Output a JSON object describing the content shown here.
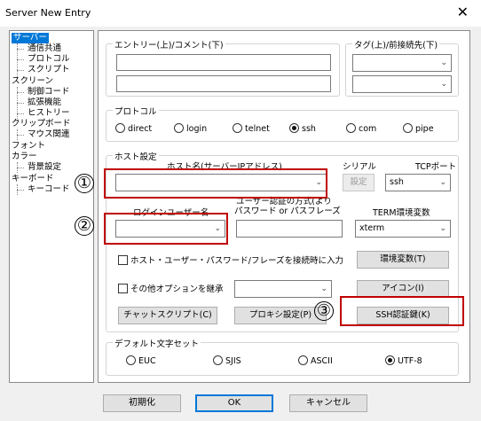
{
  "window": {
    "title": "Server New Entry",
    "close_glyph": "✕"
  },
  "tree": {
    "items": [
      {
        "label": "サーバー",
        "selected": true
      },
      {
        "label": "通信共通"
      },
      {
        "label": "プロトコル"
      },
      {
        "label": "スクリプト"
      },
      {
        "label": "スクリーン"
      },
      {
        "label": "制御コード"
      },
      {
        "label": "拡張機能"
      },
      {
        "label": "ヒストリー"
      },
      {
        "label": "クリップボード"
      },
      {
        "label": "マウス関連"
      },
      {
        "label": "フォント"
      },
      {
        "label": "カラー"
      },
      {
        "label": "背景設定"
      },
      {
        "label": "キーボード"
      },
      {
        "label": "キーコード"
      }
    ]
  },
  "entry": {
    "group_label": "エントリー(上)/コメント(下)",
    "entry_value": "",
    "comment_value": ""
  },
  "tag": {
    "group_label": "タグ(上)/前接続先(下)",
    "tag_value": "",
    "prev_value": ""
  },
  "protocol": {
    "group_label": "プロトコル",
    "options": [
      "direct",
      "login",
      "telnet",
      "ssh",
      "com",
      "pipe"
    ],
    "selected": "ssh"
  },
  "host": {
    "group_label": "ホスト設定",
    "host_label": "ホスト名(サーバーIPアドレス)",
    "host_value": "",
    "serial_label": "シリアル",
    "serial_button": "設定",
    "tcp_label": "TCPポート",
    "tcp_value": "ssh",
    "login_label": "ログインユーザー名",
    "login_value": "",
    "auth_label_1": "ユーザー認証の方式(より",
    "auth_label_2": "パスワード or パスフレーズ",
    "auth_value": "",
    "term_label": "TERM環境変数",
    "term_value": "xterm",
    "check_input": "ホスト・ユーザー・パスワード/フレーズを接続時に入力",
    "env_button": "環境変数(T)",
    "check_inherit": "その他オプションを継承",
    "inherit_value": "",
    "icon_button": "アイコン(I)",
    "chat_button": "チャットスクリプト(C)",
    "proxy_button": "プロキシ設定(P)",
    "ssh_button": "SSH認証鍵(K)"
  },
  "charset": {
    "group_label": "デフォルト文字セット",
    "options": [
      "EUC",
      "SJIS",
      "ASCII",
      "UTF-8"
    ],
    "selected": "UTF-8"
  },
  "annotations": {
    "one": "①",
    "two": "②",
    "three": "③"
  },
  "footer": {
    "init_button": "初期化",
    "ok_button": "OK",
    "cancel_button": "キャンセル"
  },
  "colors": {
    "highlight": "#c00000",
    "selection": "#0078d7"
  }
}
